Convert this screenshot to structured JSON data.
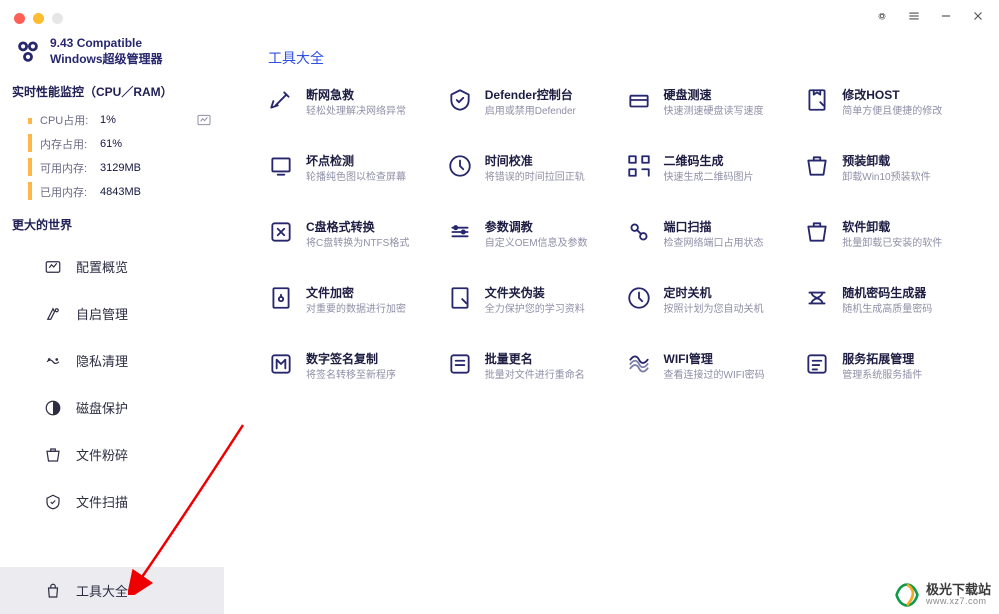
{
  "brand": {
    "line1": "9.43 Compatible",
    "line2": "Windows超级管理器"
  },
  "perf": {
    "header": "实时性能监控（CPU／RAM）",
    "rows": [
      {
        "k": "CPU占用:",
        "v": "1%"
      },
      {
        "k": "内存占用:",
        "v": "61%"
      },
      {
        "k": "可用内存:",
        "v": "3129MB"
      },
      {
        "k": "已用内存:",
        "v": "4843MB"
      }
    ]
  },
  "world_header": "更大的世界",
  "nav": [
    {
      "label": "配置概览"
    },
    {
      "label": "自启管理"
    },
    {
      "label": "隐私清理"
    },
    {
      "label": "磁盘保护"
    },
    {
      "label": "文件粉碎"
    },
    {
      "label": "文件扫描"
    },
    {
      "label": "工具大全"
    }
  ],
  "content_title": "工具大全",
  "tools": [
    {
      "t": "断网急救",
      "d": "轻松处理解决网络异常"
    },
    {
      "t": "Defender控制台",
      "d": "启用或禁用Defender"
    },
    {
      "t": "硬盘测速",
      "d": "快速测速硬盘读写速度"
    },
    {
      "t": "修改HOST",
      "d": "简单方便且便捷的修改"
    },
    {
      "t": "坏点检测",
      "d": "轮播纯色图以检查屏幕"
    },
    {
      "t": "时间校准",
      "d": "将错误的时间拉回正轨"
    },
    {
      "t": "二维码生成",
      "d": "快速生成二维码图片"
    },
    {
      "t": "预装卸载",
      "d": "卸载Win10预装软件"
    },
    {
      "t": "C盘格式转换",
      "d": "将C盘转换为NTFS格式"
    },
    {
      "t": "参数调教",
      "d": "自定义OEM信息及参数"
    },
    {
      "t": "端口扫描",
      "d": "检查网络端口占用状态"
    },
    {
      "t": "软件卸载",
      "d": "批量卸载已安装的软件"
    },
    {
      "t": "文件加密",
      "d": "对重要的数据进行加密"
    },
    {
      "t": "文件夹伪装",
      "d": "全力保护您的学习资料"
    },
    {
      "t": "定时关机",
      "d": "按照计划为您自动关机"
    },
    {
      "t": "随机密码生成器",
      "d": "随机生成高质量密码"
    },
    {
      "t": "数字签名复制",
      "d": "将签名转移至新程序"
    },
    {
      "t": "批量更名",
      "d": "批量对文件进行重命名"
    },
    {
      "t": "WIFI管理",
      "d": "查看连接过的WIFI密码"
    },
    {
      "t": "服务拓展管理",
      "d": "管理系统服务插件"
    }
  ],
  "watermark": {
    "cn": "极光下载站",
    "en": "www.xz7.com"
  }
}
